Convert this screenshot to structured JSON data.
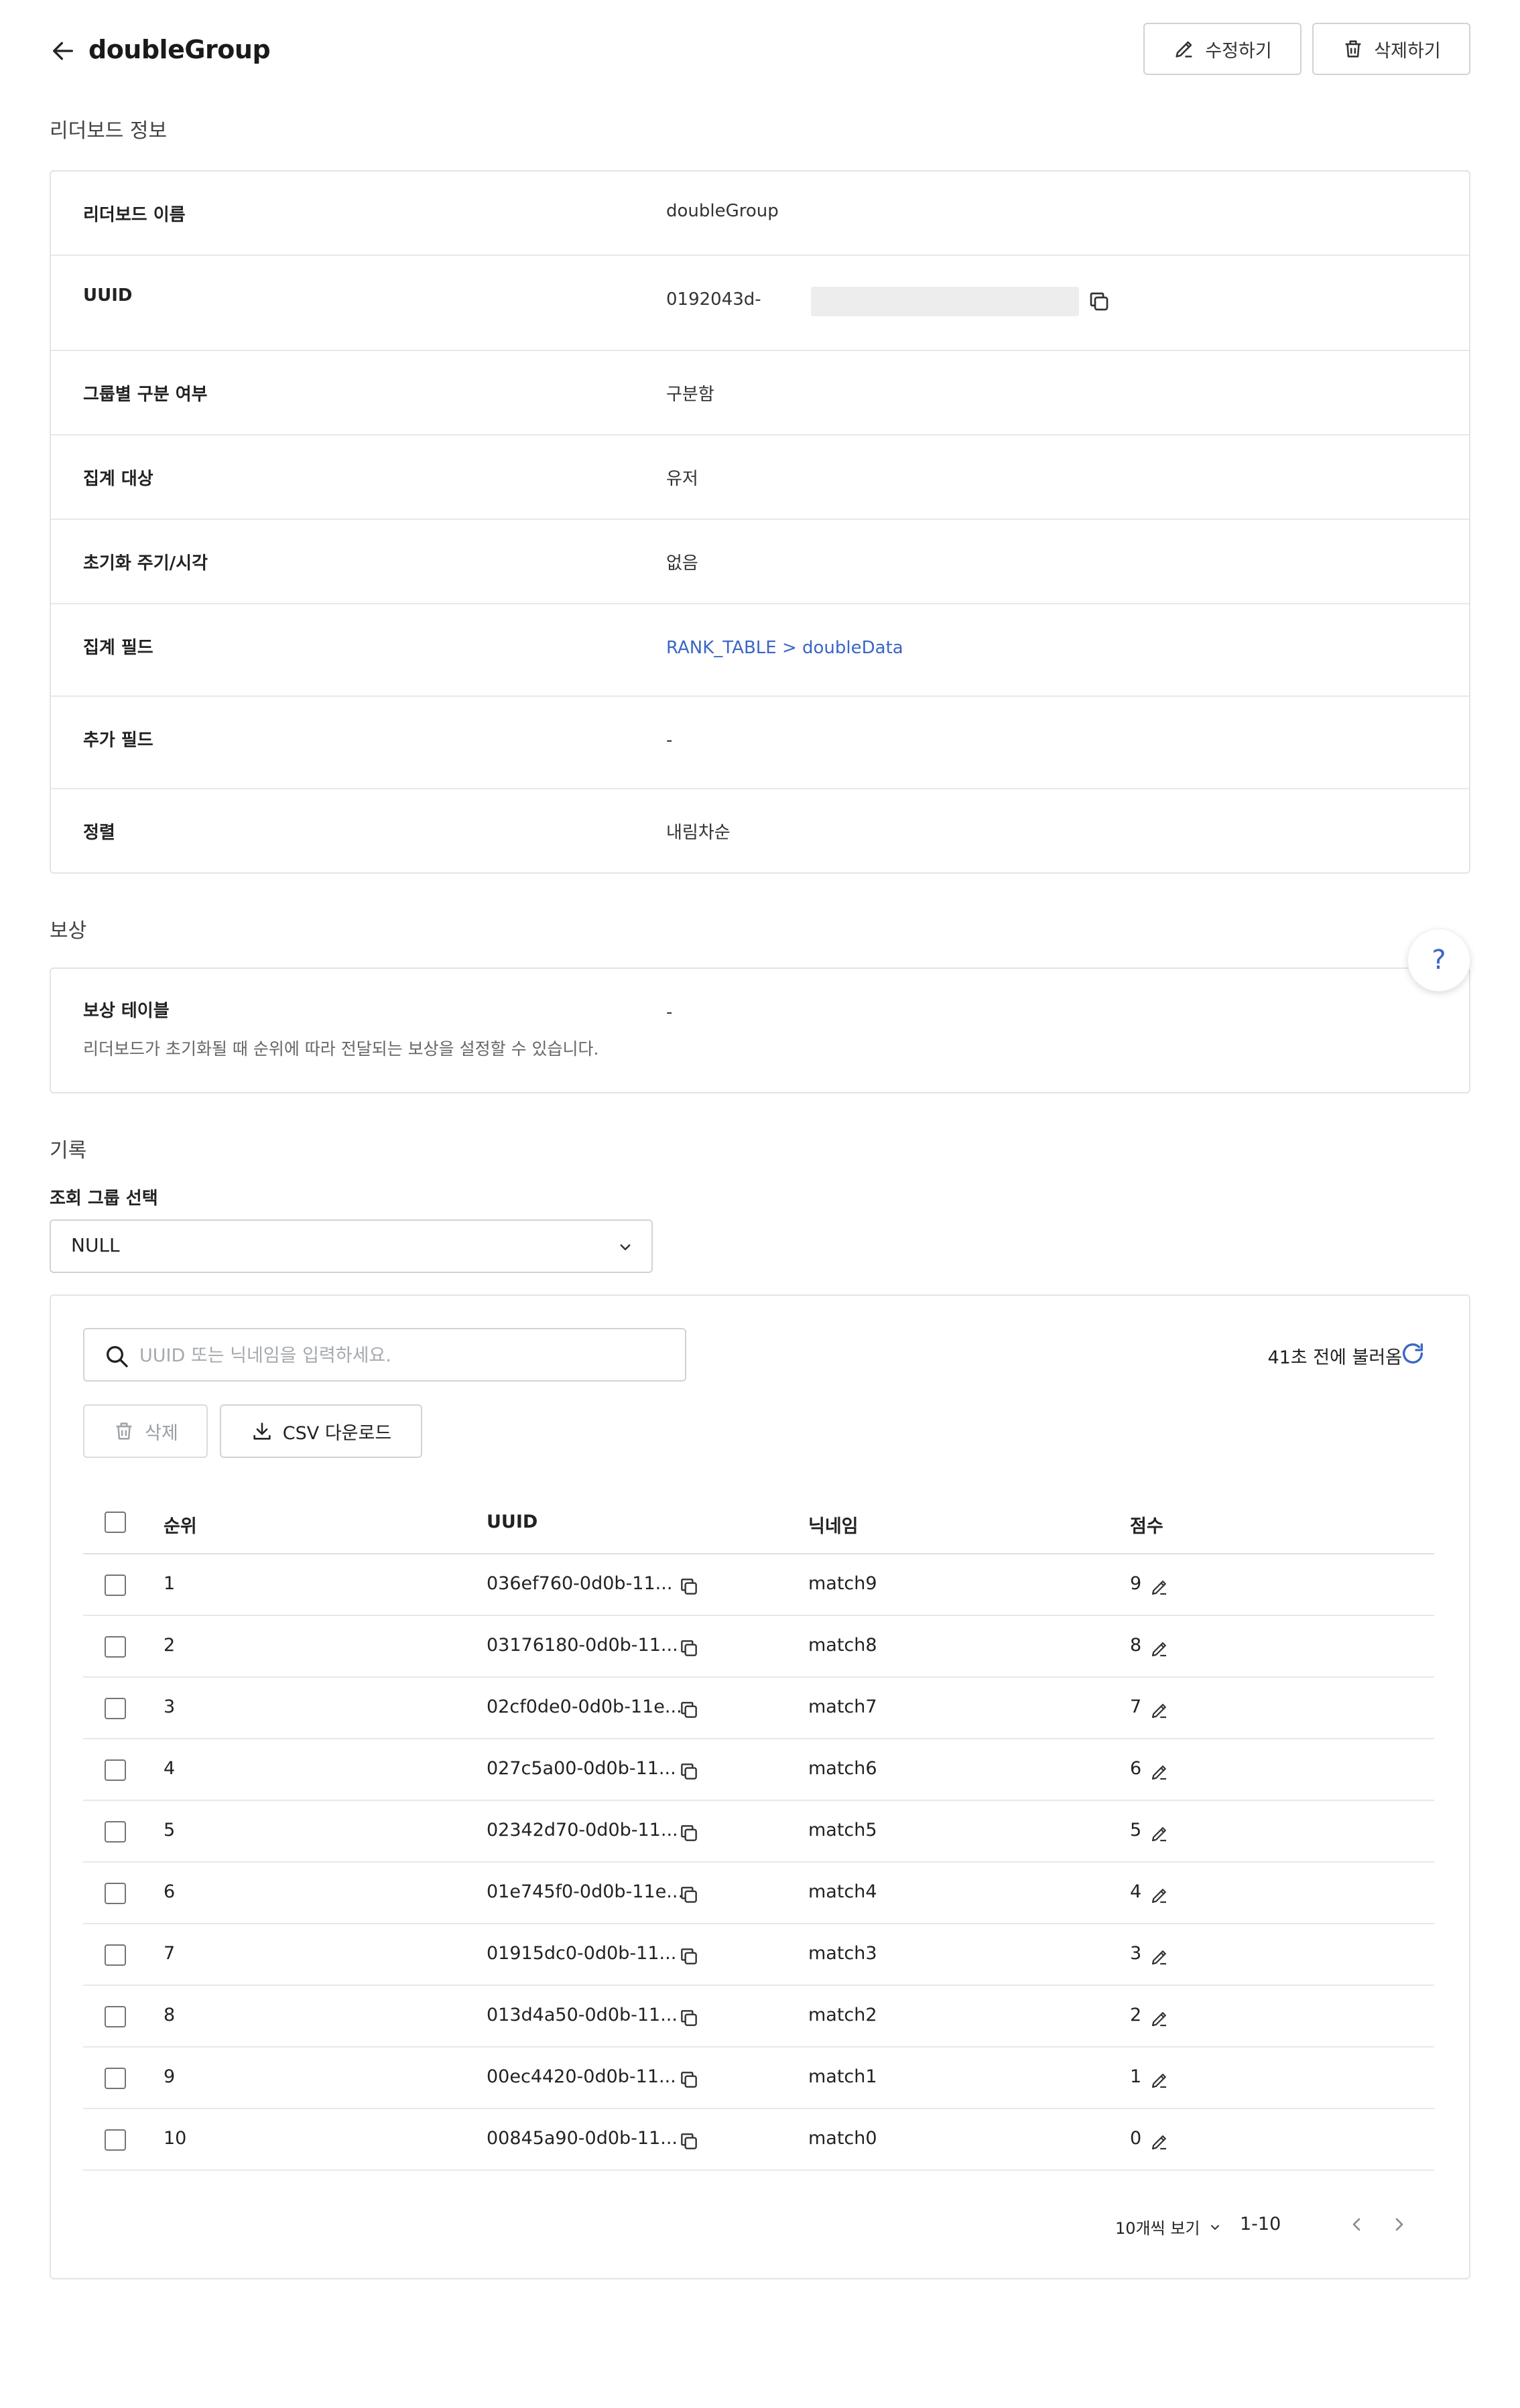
{
  "header": {
    "title": "doubleGroup",
    "edit_label": "수정하기",
    "delete_label": "삭제하기"
  },
  "info": {
    "section_title": "리더보드 정보",
    "rows": [
      {
        "label": "리더보드 이름",
        "value": "doubleGroup"
      },
      {
        "label": "UUID",
        "value": "0192043d-"
      },
      {
        "label": "그룹별 구분 여부",
        "value": "구분함"
      },
      {
        "label": "집계 대상",
        "value": "유저"
      },
      {
        "label": "초기화 주기/시각",
        "value": "없음"
      },
      {
        "label": "집계 필드",
        "value": "RANK_TABLE > doubleData"
      },
      {
        "label": "추가 필드",
        "value": "-"
      },
      {
        "label": "정렬",
        "value": "내림차순"
      }
    ]
  },
  "reward": {
    "section_title": "보상",
    "label": "보상 테이블",
    "description": "리더보드가 초기화될 때 순위에 따라 전달되는 보상을 설정할 수 있습니다.",
    "value": "-"
  },
  "help": {
    "label": "?"
  },
  "records": {
    "section_title": "기록",
    "group_label": "조회 그룹 선택",
    "group_value": "NULL",
    "search_placeholder": "UUID 또는 닉네임을 입력하세요.",
    "refresh_text": "41초 전에 불러옴",
    "delete_label": "삭제",
    "csv_label": "CSV 다운로드",
    "columns": [
      "순위",
      "UUID",
      "닉네임",
      "점수"
    ],
    "rows": [
      {
        "rank": "1",
        "uuid": "036ef760-0d0b-11...",
        "nickname": "match9",
        "score": "9"
      },
      {
        "rank": "2",
        "uuid": "03176180-0d0b-11...",
        "nickname": "match8",
        "score": "8"
      },
      {
        "rank": "3",
        "uuid": "02cf0de0-0d0b-11e...",
        "nickname": "match7",
        "score": "7"
      },
      {
        "rank": "4",
        "uuid": "027c5a00-0d0b-11...",
        "nickname": "match6",
        "score": "6"
      },
      {
        "rank": "5",
        "uuid": "02342d70-0d0b-11...",
        "nickname": "match5",
        "score": "5"
      },
      {
        "rank": "6",
        "uuid": "01e745f0-0d0b-11e...",
        "nickname": "match4",
        "score": "4"
      },
      {
        "rank": "7",
        "uuid": "01915dc0-0d0b-11...",
        "nickname": "match3",
        "score": "3"
      },
      {
        "rank": "8",
        "uuid": "013d4a50-0d0b-11...",
        "nickname": "match2",
        "score": "2"
      },
      {
        "rank": "9",
        "uuid": "00ec4420-0d0b-11...",
        "nickname": "match1",
        "score": "1"
      },
      {
        "rank": "10",
        "uuid": "00845a90-0d0b-11...",
        "nickname": "match0",
        "score": "0"
      }
    ],
    "pagination": {
      "page_size_label": "10개씩 보기",
      "range": "1-10"
    }
  },
  "colors": {
    "link": "#3a66c4",
    "border": "#e1e4e8"
  }
}
